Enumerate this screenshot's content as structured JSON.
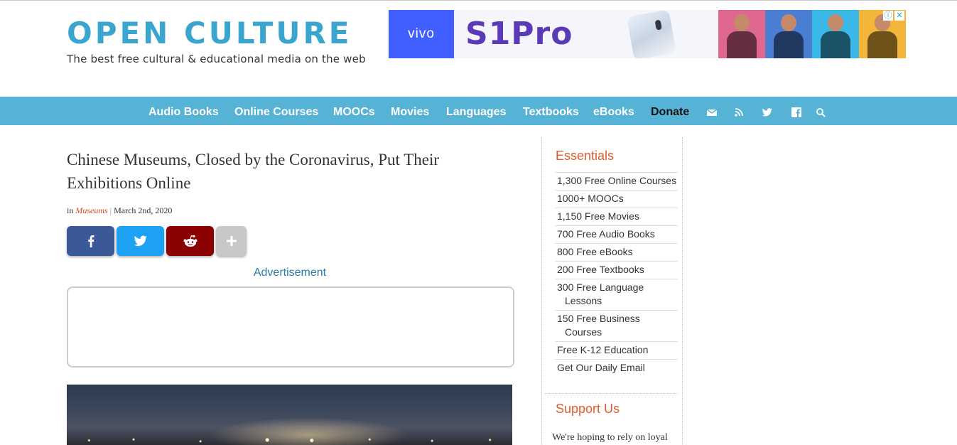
{
  "header": {
    "logo_title": "OPEN CULTURE",
    "logo_tagline": "The best free cultural & educational media on the web"
  },
  "ad_banner": {
    "brand": "vivo",
    "product": "S1Pro",
    "controls": [
      "ⓘ",
      "✕"
    ]
  },
  "nav": {
    "items": [
      {
        "label": "Audio Books"
      },
      {
        "label": "Online Courses"
      },
      {
        "label": "MOOCs"
      },
      {
        "label": "Movies"
      },
      {
        "label": "Languages"
      },
      {
        "label": "Textbooks"
      },
      {
        "label": "eBooks"
      },
      {
        "label": "Donate"
      }
    ],
    "icons": [
      "mail-icon",
      "rss-icon",
      "twitter-icon",
      "facebook-icon",
      "search-icon"
    ]
  },
  "article": {
    "title": "Chinese Museums, Closed by the Coronavirus, Put Their Exhibitions Online",
    "meta_prefix": "in",
    "category": "Museums",
    "meta_separator": "|",
    "date": "March 2nd, 2020",
    "share_buttons": [
      {
        "network": "facebook",
        "color": "#3b5998",
        "icon": "facebook-icon"
      },
      {
        "network": "twitter",
        "color": "#1da1f2",
        "icon": "twitter-icon"
      },
      {
        "network": "reddit",
        "color": "#8b0000",
        "icon": "reddit-icon"
      },
      {
        "network": "more",
        "color": "#c8c8c8",
        "icon": "plus-icon"
      }
    ],
    "ad_label": "Advertisement"
  },
  "sidebar": {
    "essentials_heading": "Essentials",
    "essentials": [
      {
        "label": "1,300 Free Online Courses"
      },
      {
        "label": "1000+ MOOCs"
      },
      {
        "label": "1,150 Free Movies"
      },
      {
        "label": "700 Free Audio Books"
      },
      {
        "label": "800 Free eBooks"
      },
      {
        "label": "200 Free Textbooks"
      },
      {
        "label": "300 Free Language Lessons"
      },
      {
        "label": "150 Free Business Courses"
      },
      {
        "label": "Free K-12 Education"
      },
      {
        "label": "Get Our Daily Email"
      }
    ],
    "support_heading": "Support Us",
    "support_text": "We're hoping to rely on loyal"
  },
  "colors": {
    "brand_blue": "#3aa6cf",
    "nav_bg": "#57b3d6",
    "accent_orange": "#e05a2b",
    "link_red": "#d0482a"
  }
}
